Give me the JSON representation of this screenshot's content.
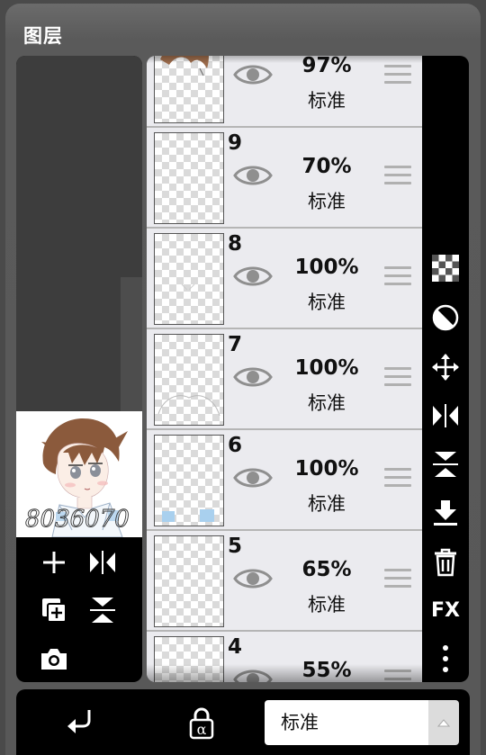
{
  "panel": {
    "title": "图层"
  },
  "layers": [
    {
      "number": "",
      "opacity": "97%",
      "blend": "标准"
    },
    {
      "number": "9",
      "opacity": "70%",
      "blend": "标准"
    },
    {
      "number": "8",
      "opacity": "100%",
      "blend": "标准"
    },
    {
      "number": "7",
      "opacity": "100%",
      "blend": "标准"
    },
    {
      "number": "6",
      "opacity": "100%",
      "blend": "标准"
    },
    {
      "number": "5",
      "opacity": "65%",
      "blend": "标准"
    },
    {
      "number": "4",
      "opacity": "55%",
      "blend": "标准"
    }
  ],
  "preview": {
    "signature_text": "8036070"
  },
  "right_toolbar": {
    "fx_label": "FX"
  },
  "bottom_bar": {
    "blend_mode": "标准"
  },
  "colors": {
    "accent_black": "#000000",
    "list_bg": "#ebebef",
    "panel_bg": "#5a5a5a"
  },
  "icons": [
    "add-layer-icon",
    "flip-horizontal-icon",
    "duplicate-layer-icon",
    "flip-vertical-icon",
    "camera-icon",
    "checkerboard-icon",
    "half-circle-icon",
    "move-icon",
    "flip-horizontal-icon",
    "flip-vertical-icon",
    "merge-down-icon",
    "trash-icon",
    "more-vertical-icon",
    "clip-arrow-icon",
    "alpha-lock-icon",
    "eye-icon",
    "drag-handle-icon",
    "chevron-up-icon"
  ]
}
